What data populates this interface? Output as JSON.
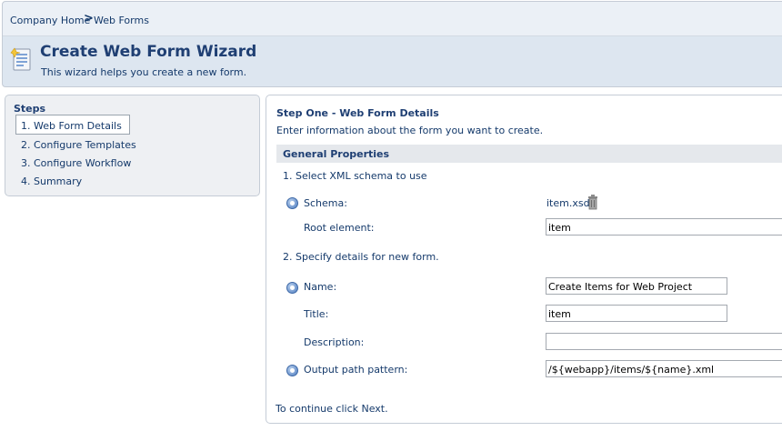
{
  "breadcrumb": {
    "home": "Company Home",
    "separator": ">",
    "current": "Web Forms"
  },
  "header": {
    "title": "Create Web Form Wizard",
    "description": "This wizard helps you create a new form.",
    "icon": "wizard-form-icon"
  },
  "steps": {
    "title": "Steps",
    "items": [
      {
        "label": "1. Web Form Details",
        "active": true
      },
      {
        "label": "2. Configure Templates",
        "active": false
      },
      {
        "label": "3. Configure Workflow",
        "active": false
      },
      {
        "label": "4. Summary",
        "active": false
      }
    ]
  },
  "main": {
    "step_title": "Step One - Web Form Details",
    "step_subtitle": "Enter information about the form you want to create.",
    "section_title": "General Properties",
    "schema_section": "1. Select XML schema to use",
    "schema_label": "Schema:",
    "schema_value": "item.xsd",
    "root_label": "Root element:",
    "root_value": "item",
    "details_section": "2. Specify details for new form.",
    "name_label": "Name:",
    "name_value": "Create Items for Web Project",
    "title_label": "Title:",
    "title_value": "item",
    "description_label": "Description:",
    "description_value": "",
    "output_label": "Output path pattern:",
    "output_value": "/${webapp}/items/${name}.xml",
    "footer": "To continue click Next."
  },
  "colors": {
    "heading": "#1f3f73",
    "text": "#153a6b",
    "header_bg": "#dde6f0",
    "panel_bg": "#eef0f3"
  }
}
